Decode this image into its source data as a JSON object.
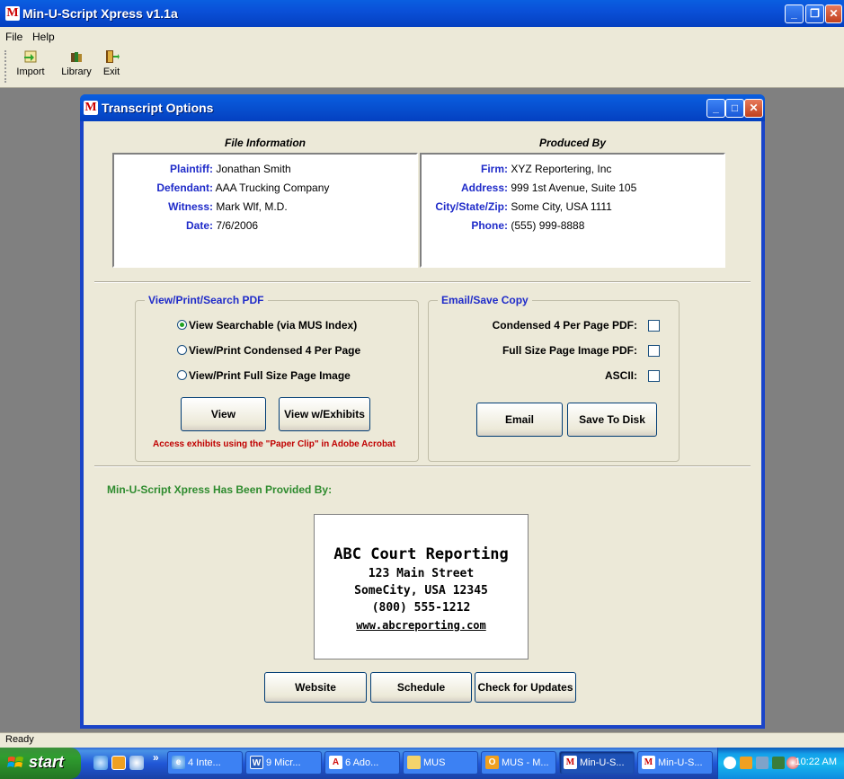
{
  "app": {
    "title": "Min-U-Script Xpress v1.1a",
    "icon_letter": "M"
  },
  "menu": [
    "File",
    "Help"
  ],
  "toolbar": {
    "import_label": "Import",
    "library_label": "Library",
    "exit_label": "Exit"
  },
  "dialog": {
    "title": "Transcript Options",
    "file_info": {
      "heading": "File Information",
      "rows": [
        {
          "label": "Plaintiff:",
          "value": "Jonathan Smith"
        },
        {
          "label": "Defendant:",
          "value": "AAA Trucking Company"
        },
        {
          "label": "Witness:",
          "value": "Mark Wlf, M.D."
        },
        {
          "label": "Date:",
          "value": "7/6/2006"
        }
      ]
    },
    "produced_by": {
      "heading": "Produced By",
      "rows": [
        {
          "label": "Firm:",
          "value": "XYZ Reportering, Inc"
        },
        {
          "label": "Address:",
          "value": "999 1st Avenue, Suite 105"
        },
        {
          "label": "City/State/Zip:",
          "value": "Some City, USA 1111"
        },
        {
          "label": "Phone:",
          "value": "(555) 999-8888"
        }
      ]
    },
    "view_print": {
      "legend": "View/Print/Search PDF",
      "options": [
        {
          "label": "View Searchable (via MUS Index)",
          "selected": true
        },
        {
          "label": "View/Print Condensed 4 Per Page",
          "selected": false
        },
        {
          "label": "View/Print Full Size Page Image",
          "selected": false
        }
      ],
      "view_button": "View",
      "view_exhibits_button": "View w/Exhibits",
      "note": "Access exhibits using the \"Paper Clip\" in Adobe Acrobat"
    },
    "email_save": {
      "legend": "Email/Save Copy",
      "options": [
        {
          "label": "Condensed 4 Per Page PDF:",
          "checked": false
        },
        {
          "label": "Full Size Page Image PDF:",
          "checked": false
        },
        {
          "label": "ASCII:",
          "checked": false
        }
      ],
      "email_button": "Email",
      "save_button": "Save To Disk"
    },
    "provided_by": "Min-U-Script Xpress Has Been Provided By:",
    "logo": {
      "name": "ABC Court Reporting",
      "street": "123 Main Street",
      "city": "SomeCity, USA 12345",
      "phone": "(800) 555-1212",
      "web": "www.abcreporting.com"
    },
    "website_button": "Website",
    "schedule_button": "Schedule",
    "updates_button": "Check for Updates"
  },
  "status": "Ready",
  "taskbar": {
    "start_label": "start",
    "chevron": "»",
    "items": [
      {
        "label": "4 Inte...",
        "icon": "ie-icon"
      },
      {
        "label": "9 Micr...",
        "icon": "word-icon"
      },
      {
        "label": "6 Ado...",
        "icon": "acrobat-icon"
      },
      {
        "label": "MUS",
        "icon": "folder-icon"
      },
      {
        "label": "MUS - M...",
        "icon": "outlook-icon"
      },
      {
        "label": "Min-U-S...",
        "icon": "mus-icon"
      },
      {
        "label": "Min-U-S...",
        "icon": "mus-icon"
      }
    ],
    "clock": "10:22 AM"
  },
  "colors": {
    "title_blue": "#0a50d8",
    "label_blue": "#1f2bc9",
    "provided_green": "#2e8b2e",
    "note_red": "#c00000",
    "face": "#ece9d8"
  }
}
